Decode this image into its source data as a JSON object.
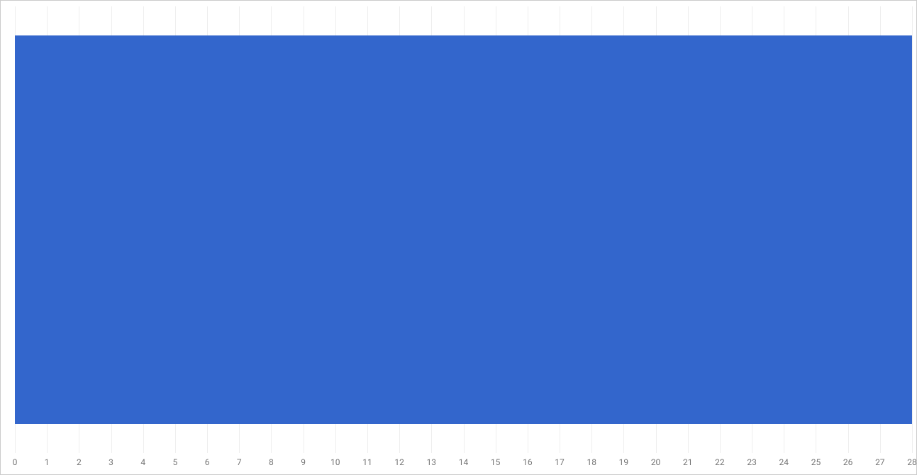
{
  "chart_data": {
    "type": "bar",
    "orientation": "horizontal",
    "categories": [
      ""
    ],
    "values": [
      28
    ],
    "xlim": [
      0,
      28
    ],
    "xticks": [
      0,
      1,
      2,
      3,
      4,
      5,
      6,
      7,
      8,
      9,
      10,
      11,
      12,
      13,
      14,
      15,
      16,
      17,
      18,
      19,
      20,
      21,
      22,
      23,
      24,
      25,
      26,
      27,
      28
    ],
    "colors": {
      "bar": "#3366cc",
      "grid": "#e0e0e0",
      "tick_text": "#757575"
    },
    "title": "",
    "xlabel": "",
    "ylabel": ""
  }
}
